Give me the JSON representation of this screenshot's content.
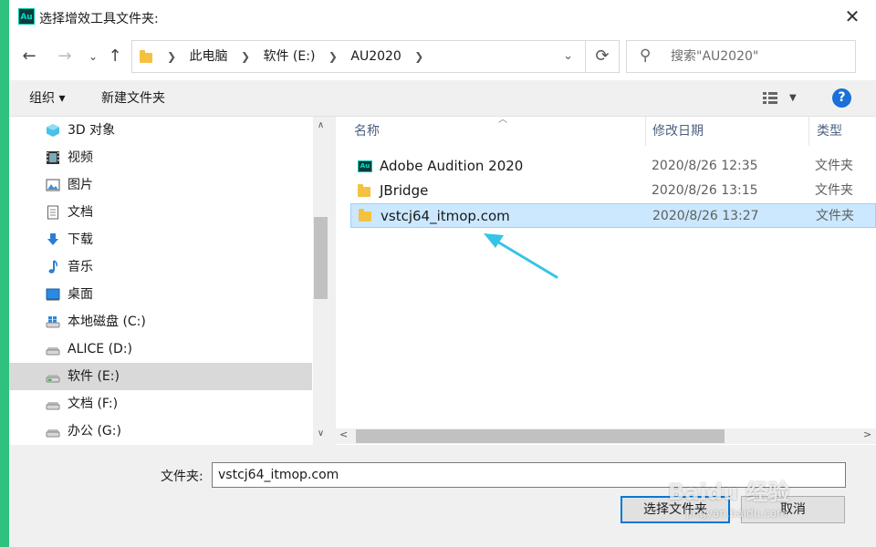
{
  "dialog": {
    "title": "选择增效工具文件夹:",
    "app_icon_text": "Au"
  },
  "nav": {
    "breadcrumb": [
      "此电脑",
      "软件 (E:)",
      "AU2020"
    ],
    "search_placeholder": "搜索\"AU2020\""
  },
  "toolbar": {
    "organize_label": "组织 ▾",
    "new_folder_label": "新建文件夹",
    "help_label": "?"
  },
  "sidebar": {
    "items": [
      {
        "label": "3D 对象",
        "icon": "3d-objects-icon"
      },
      {
        "label": "视频",
        "icon": "video-icon"
      },
      {
        "label": "图片",
        "icon": "pictures-icon"
      },
      {
        "label": "文档",
        "icon": "documents-icon"
      },
      {
        "label": "下载",
        "icon": "download-icon"
      },
      {
        "label": "音乐",
        "icon": "music-icon"
      },
      {
        "label": "桌面",
        "icon": "desktop-icon"
      },
      {
        "label": "本地磁盘 (C:)",
        "icon": "windows-drive-icon"
      },
      {
        "label": "ALICE (D:)",
        "icon": "drive-icon"
      },
      {
        "label": "软件 (E:)",
        "icon": "drive-icon",
        "selected": true
      },
      {
        "label": "文档 (F:)",
        "icon": "drive-icon"
      },
      {
        "label": "办公 (G:)",
        "icon": "drive-icon"
      }
    ]
  },
  "files": {
    "columns": {
      "name": "名称",
      "date": "修改日期",
      "type": "类型"
    },
    "rows": [
      {
        "name": "Adobe Audition 2020",
        "date": "2020/8/26 12:35",
        "type": "文件夹",
        "icon": "audition-folder-icon"
      },
      {
        "name": "JBridge",
        "date": "2020/8/26 13:15",
        "type": "文件夹",
        "icon": "folder-icon"
      },
      {
        "name": "vstcj64_itmop.com",
        "date": "2020/8/26 13:27",
        "type": "文件夹",
        "icon": "folder-icon",
        "selected": true
      }
    ]
  },
  "bottom": {
    "folder_label": "文件夹:",
    "folder_value": "vstcj64_itmop.com",
    "select_button": "选择文件夹",
    "cancel_button": "取消"
  },
  "watermark": {
    "text": "Baidu 经验",
    "sub": "jingyan.baidu.com"
  },
  "colors": {
    "accent": "#0078d7",
    "selection": "#cce8ff",
    "annotation_arrow": "#35c4e8"
  }
}
